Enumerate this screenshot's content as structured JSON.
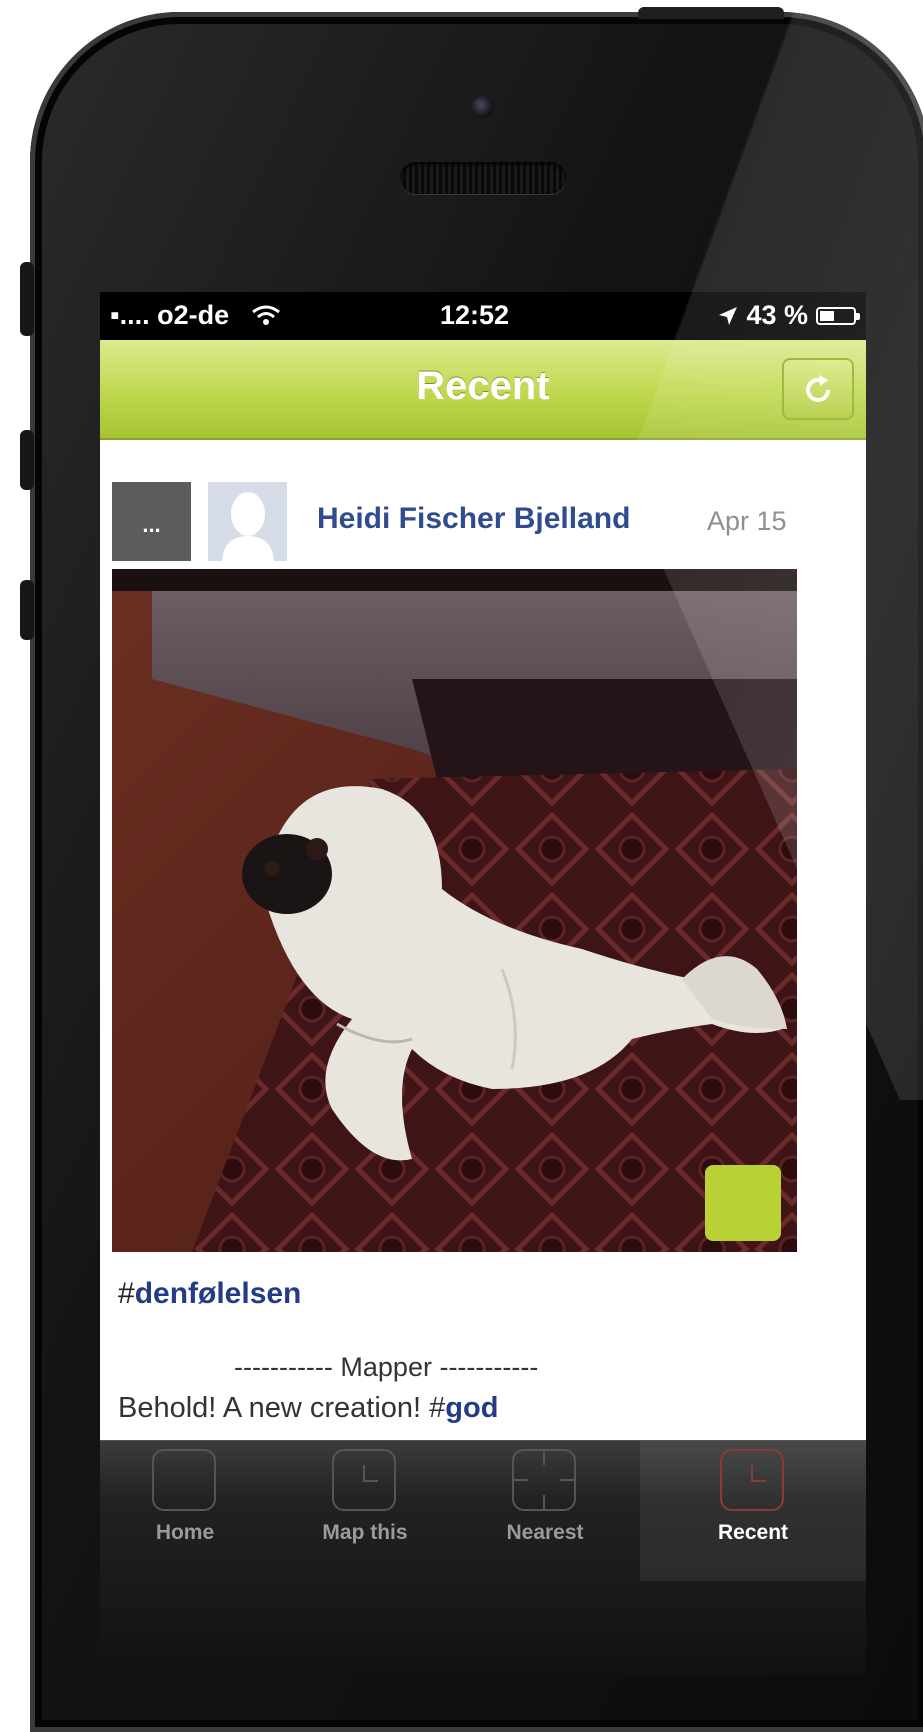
{
  "status_bar": {
    "carrier": "▪.... o2-de",
    "time": "12:52",
    "battery": "43 %",
    "battery_level": 0.43
  },
  "nav": {
    "title": "Recent",
    "refresh_icon": "refresh-icon"
  },
  "post": {
    "more_label": "...",
    "author": "Heidi Fischer Bjelland",
    "date": "Apr 15",
    "hashtag_prefix": "#",
    "hashtag": "denfølelsen",
    "mapper_label": "----------- Mapper -----------",
    "caption_text": "Behold! A new creation! #",
    "caption_tag": "god"
  },
  "tabs": [
    {
      "label": "Home",
      "icon": "home-icon",
      "active": false
    },
    {
      "label": "Map this",
      "icon": "clock-icon",
      "active": false
    },
    {
      "label": "Nearest",
      "icon": "crosshair-icon",
      "active": false
    },
    {
      "label": "Recent",
      "icon": "clock-icon",
      "active": true
    }
  ],
  "colors": {
    "accent": "#b8d235",
    "link": "#304c8e",
    "tabbar": "#1a1a1a"
  }
}
